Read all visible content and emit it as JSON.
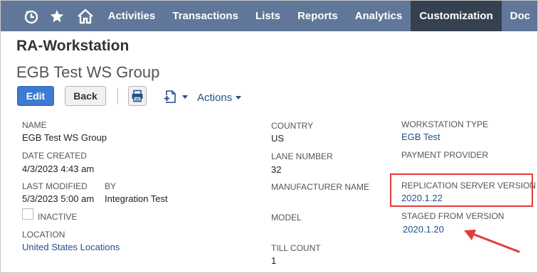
{
  "nav": {
    "items": [
      "Activities",
      "Transactions",
      "Lists",
      "Reports",
      "Analytics",
      "Customization",
      "Doc"
    ],
    "active": "Customization",
    "icons": [
      "recent-records-icon",
      "star-icon",
      "home-icon"
    ]
  },
  "record": {
    "type": "RA-Workstation",
    "name": "EGB Test WS Group"
  },
  "buttons": {
    "edit": "Edit",
    "back": "Back",
    "actions": "Actions"
  },
  "fields": {
    "name": {
      "label": "NAME",
      "value": "EGB Test WS Group"
    },
    "date_created": {
      "label": "DATE CREATED",
      "value": "4/3/2023 4:43 am"
    },
    "last_modified": {
      "label": "LAST MODIFIED",
      "value": "5/3/2023 5:00 am"
    },
    "by": {
      "label": "BY",
      "value": "Integration Test"
    },
    "inactive": {
      "label": "INACTIVE"
    },
    "location": {
      "label": "LOCATION",
      "value": "United States Locations"
    },
    "country": {
      "label": "COUNTRY",
      "value": "US"
    },
    "lane_number": {
      "label": "LANE NUMBER",
      "value": "32"
    },
    "manufacturer_name": {
      "label": "MANUFACTURER NAME"
    },
    "model": {
      "label": "MODEL"
    },
    "till_count": {
      "label": "TILL COUNT",
      "value": "1"
    },
    "workstation_type": {
      "label": "WORKSTATION TYPE",
      "value": "EGB Test"
    },
    "payment_provider": {
      "label": "PAYMENT PROVIDER"
    },
    "replication_server_version": {
      "label": "REPLICATION SERVER VERSION",
      "value": "2020.1.22"
    },
    "staged_from_version": {
      "label": "STAGED FROM VERSION",
      "value": "2020.1.20"
    }
  },
  "colors": {
    "nav_bg": "#607799",
    "nav_active": "#36414f",
    "edit_button": "#3d7ad1",
    "link": "#24508a",
    "annotation": "#e23b3b"
  }
}
